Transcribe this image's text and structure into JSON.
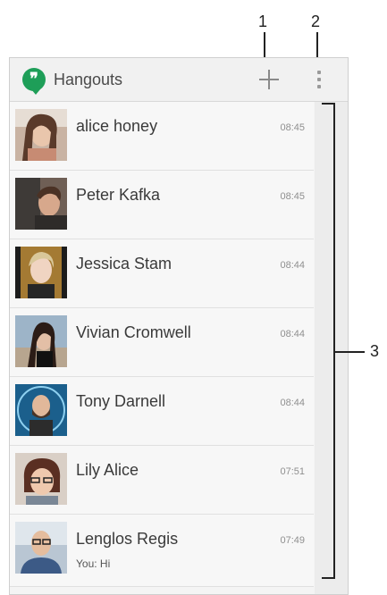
{
  "callouts": {
    "add_number": "1",
    "menu_number": "2",
    "list_number": "3"
  },
  "app": {
    "title": "Hangouts",
    "logo_icon": "hangouts-logo-icon",
    "add_icon": "plus-icon",
    "menu_icon": "overflow-menu-icon",
    "brand_color": "#1e9e58"
  },
  "conversations": [
    {
      "name": "alice honey",
      "time": "08:45",
      "snippet": ""
    },
    {
      "name": "Peter Kafka",
      "time": "08:45",
      "snippet": ""
    },
    {
      "name": "Jessica Stam",
      "time": "08:44",
      "snippet": ""
    },
    {
      "name": "Vivian Cromwell",
      "time": "08:44",
      "snippet": ""
    },
    {
      "name": "Tony Darnell",
      "time": "08:44",
      "snippet": ""
    },
    {
      "name": "Lily Alice",
      "time": "07:51",
      "snippet": ""
    },
    {
      "name": "Lenglos Regis",
      "time": "07:49",
      "snippet": "You: Hi"
    }
  ]
}
